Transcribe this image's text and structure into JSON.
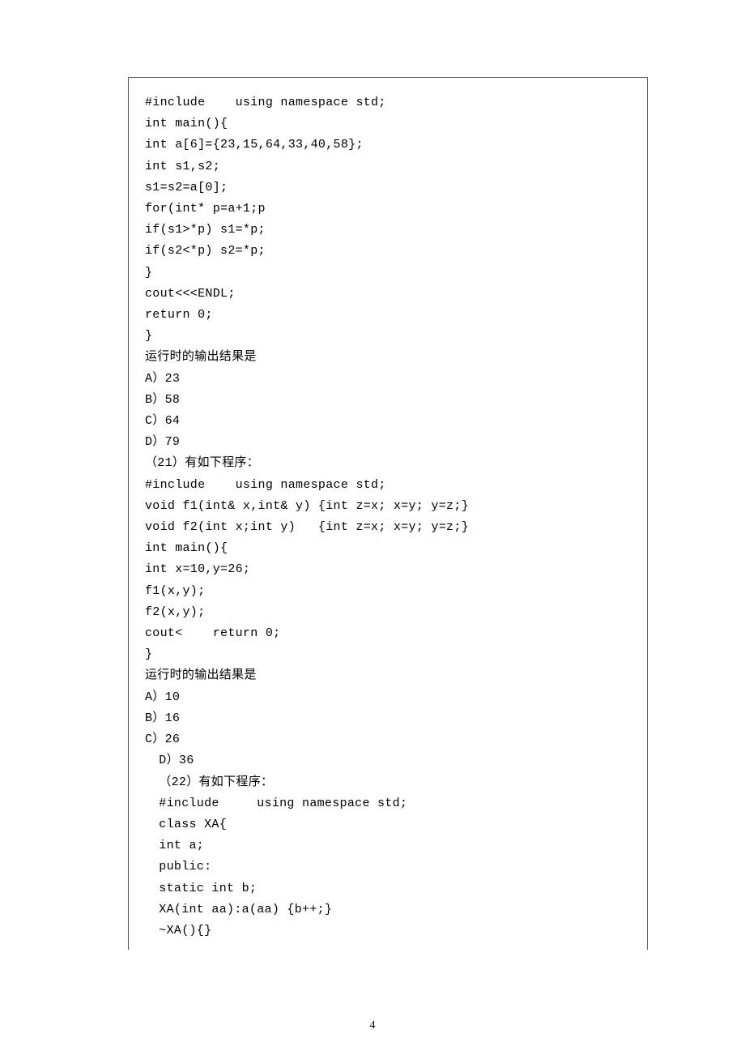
{
  "lines": [
    {
      "text": "#include    using namespace std;",
      "indent": 0
    },
    {
      "text": "int main(){",
      "indent": 0
    },
    {
      "text": "int a[6]={23,15,64,33,40,58};",
      "indent": 0
    },
    {
      "text": "int s1,s2;",
      "indent": 0
    },
    {
      "text": "s1=s2=a[0];",
      "indent": 0
    },
    {
      "text": "for(int* p=a+1;p",
      "indent": 0
    },
    {
      "text": "if(s1>*p) s1=*p;",
      "indent": 0
    },
    {
      "text": "if(s2<*p) s2=*p;",
      "indent": 0
    },
    {
      "text": "}",
      "indent": 0
    },
    {
      "text": "cout<<<ENDL;",
      "indent": 0
    },
    {
      "text": "return 0;",
      "indent": 0
    },
    {
      "text": "}",
      "indent": 0
    },
    {
      "text": "运行时的输出结果是",
      "indent": 0
    },
    {
      "text": "A）23",
      "indent": 0
    },
    {
      "text": "B）58",
      "indent": 0
    },
    {
      "text": "C）64",
      "indent": 0
    },
    {
      "text": "D）79",
      "indent": 0
    },
    {
      "text": "（21）有如下程序：",
      "indent": 0
    },
    {
      "text": "#include    using namespace std;",
      "indent": 0
    },
    {
      "text": "void f1(int& x,int& y) {int z=x; x=y; y=z;}",
      "indent": 0
    },
    {
      "text": "void f2(int x;int y)   {int z=x; x=y; y=z;}",
      "indent": 0
    },
    {
      "text": "int main(){",
      "indent": 0
    },
    {
      "text": "int x=10,y=26;",
      "indent": 0
    },
    {
      "text": "f1(x,y);",
      "indent": 0
    },
    {
      "text": "f2(x,y);",
      "indent": 0
    },
    {
      "text": "cout<    return 0;",
      "indent": 0
    },
    {
      "text": "}",
      "indent": 0
    },
    {
      "text": "运行时的输出结果是",
      "indent": 0
    },
    {
      "text": "A）10",
      "indent": 0
    },
    {
      "text": "B）16",
      "indent": 0
    },
    {
      "text": "C）26",
      "indent": 0
    },
    {
      "text": " D）36",
      "indent": 1
    },
    {
      "text": " （22）有如下程序：",
      "indent": 1
    },
    {
      "text": " #include     using namespace std;",
      "indent": 1
    },
    {
      "text": " class XA{",
      "indent": 1
    },
    {
      "text": " int a;",
      "indent": 1
    },
    {
      "text": " public:",
      "indent": 1
    },
    {
      "text": " static int b;",
      "indent": 1
    },
    {
      "text": " XA(int aa):a(aa) {b++;}",
      "indent": 1
    },
    {
      "text": " ~XA(){}",
      "indent": 1
    }
  ],
  "page_number": "4"
}
